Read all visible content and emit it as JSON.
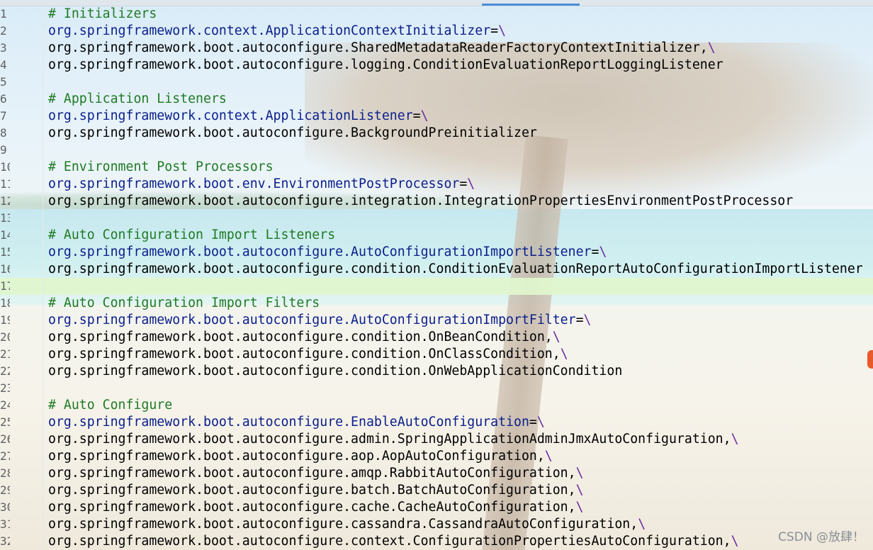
{
  "editor": {
    "lines": [
      {
        "n": "1",
        "kind": "comment",
        "text": "# Initializers"
      },
      {
        "n": "2",
        "kind": "key",
        "text": "org.springframework.context.ApplicationContextInitializer",
        "suffix": "=\\"
      },
      {
        "n": "3",
        "kind": "value",
        "text": "org.springframework.boot.autoconfigure.SharedMetadataReaderFactoryContextInitializer,",
        "suffix": "\\"
      },
      {
        "n": "4",
        "kind": "value",
        "text": "org.springframework.boot.autoconfigure.logging.ConditionEvaluationReportLoggingListener",
        "suffix": ""
      },
      {
        "n": "5",
        "kind": "blank",
        "text": ""
      },
      {
        "n": "6",
        "kind": "comment",
        "text": "# Application Listeners"
      },
      {
        "n": "7",
        "kind": "key",
        "text": "org.springframework.context.ApplicationListener",
        "suffix": "=\\"
      },
      {
        "n": "8",
        "kind": "value",
        "text": "org.springframework.boot.autoconfigure.BackgroundPreinitializer",
        "suffix": ""
      },
      {
        "n": "9",
        "kind": "blank",
        "text": ""
      },
      {
        "n": "10",
        "kind": "comment",
        "text": "# Environment Post Processors"
      },
      {
        "n": "11",
        "kind": "key",
        "text": "org.springframework.boot.env.EnvironmentPostProcessor",
        "suffix": "=\\"
      },
      {
        "n": "12",
        "kind": "value",
        "text": "org.springframework.boot.autoconfigure.integration.IntegrationPropertiesEnvironmentPostProcessor",
        "suffix": ""
      },
      {
        "n": "13",
        "kind": "blank",
        "text": ""
      },
      {
        "n": "14",
        "kind": "comment",
        "text": "# Auto Configuration Import Listeners"
      },
      {
        "n": "15",
        "kind": "key",
        "text": "org.springframework.boot.autoconfigure.AutoConfigurationImportListener",
        "suffix": "=\\"
      },
      {
        "n": "16",
        "kind": "value",
        "text": "org.springframework.boot.autoconfigure.condition.ConditionEvaluationReportAutoConfigurationImportListener",
        "suffix": ""
      },
      {
        "n": "17",
        "kind": "blank",
        "text": ""
      },
      {
        "n": "18",
        "kind": "comment",
        "text": "# Auto Configuration Import Filters"
      },
      {
        "n": "19",
        "kind": "key",
        "text": "org.springframework.boot.autoconfigure.AutoConfigurationImportFilter",
        "suffix": "=\\"
      },
      {
        "n": "20",
        "kind": "value",
        "text": "org.springframework.boot.autoconfigure.condition.OnBeanCondition,",
        "suffix": "\\"
      },
      {
        "n": "21",
        "kind": "value",
        "text": "org.springframework.boot.autoconfigure.condition.OnClassCondition,",
        "suffix": "\\"
      },
      {
        "n": "22",
        "kind": "value",
        "text": "org.springframework.boot.autoconfigure.condition.OnWebApplicationCondition",
        "suffix": ""
      },
      {
        "n": "23",
        "kind": "blank",
        "text": ""
      },
      {
        "n": "24",
        "kind": "comment",
        "text": "# Auto Configure"
      },
      {
        "n": "25",
        "kind": "key",
        "text": "org.springframework.boot.autoconfigure.EnableAutoConfiguration",
        "suffix": "=\\"
      },
      {
        "n": "26",
        "kind": "value",
        "text": "org.springframework.boot.autoconfigure.admin.SpringApplicationAdminJmxAutoConfiguration,",
        "suffix": "\\"
      },
      {
        "n": "27",
        "kind": "value",
        "text": "org.springframework.boot.autoconfigure.aop.AopAutoConfiguration,",
        "suffix": "\\"
      },
      {
        "n": "28",
        "kind": "value",
        "text": "org.springframework.boot.autoconfigure.amqp.RabbitAutoConfiguration,",
        "suffix": "\\"
      },
      {
        "n": "29",
        "kind": "value",
        "text": "org.springframework.boot.autoconfigure.batch.BatchAutoConfiguration,",
        "suffix": "\\"
      },
      {
        "n": "30",
        "kind": "value",
        "text": "org.springframework.boot.autoconfigure.cache.CacheAutoConfiguration,",
        "suffix": "\\"
      },
      {
        "n": "31",
        "kind": "value",
        "text": "org.springframework.boot.autoconfigure.cassandra.CassandraAutoConfiguration,",
        "suffix": "\\"
      },
      {
        "n": "32",
        "kind": "value",
        "text": "org.springframework.boot.autoconfigure.context.ConfigurationPropertiesAutoConfiguration,",
        "suffix": "\\"
      }
    ],
    "current_line": "17"
  },
  "watermark": "CSDN @放肆！",
  "colors": {
    "comment": "#1f7a24",
    "key": "#0a1e8c",
    "value": "#000000",
    "continuation": "#6a2a9e",
    "current_line_highlight": "#dff6ce"
  }
}
